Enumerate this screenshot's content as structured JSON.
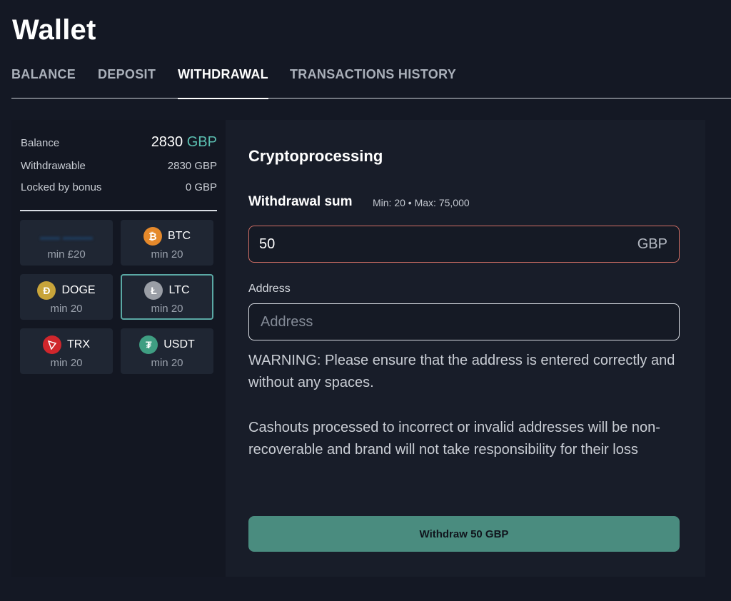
{
  "page_title": "Wallet",
  "tabs": [
    {
      "label": "BALANCE",
      "active": false
    },
    {
      "label": "DEPOSIT",
      "active": false
    },
    {
      "label": "WITHDRAWAL",
      "active": true
    },
    {
      "label": "TRANSACTIONS HISTORY",
      "active": false
    }
  ],
  "balance": {
    "balance_label": "Balance",
    "balance_amount": "2830",
    "balance_currency": "GBP",
    "withdrawable_label": "Withdrawable",
    "withdrawable_value": "2830 GBP",
    "locked_label": "Locked by bonus",
    "locked_value": "0 GBP"
  },
  "methods": [
    {
      "name": "",
      "min": "min £20",
      "icon": "blurred-brand-logo",
      "selected": false
    },
    {
      "name": "BTC",
      "min": "min 20",
      "icon": "bitcoin-icon",
      "color": "#e5892b",
      "selected": false
    },
    {
      "name": "DOGE",
      "min": "min 20",
      "icon": "dogecoin-icon",
      "color": "#c8a43a",
      "selected": false
    },
    {
      "name": "LTC",
      "min": "min 20",
      "icon": "litecoin-icon",
      "color": "#9a9ea6",
      "selected": true
    },
    {
      "name": "TRX",
      "min": "min 20",
      "icon": "tron-icon",
      "color": "#d0262c",
      "selected": false
    },
    {
      "name": "USDT",
      "min": "min 20",
      "icon": "tether-icon",
      "color": "#3f9e82",
      "selected": false
    }
  ],
  "form": {
    "title": "Cryptoprocessing",
    "sum_label": "Withdrawal sum",
    "sum_hint": "Min: 20 • Max: 75,000",
    "sum_value": "50",
    "sum_currency": "GBP",
    "address_label": "Address",
    "address_placeholder": "Address",
    "warning_text": "WARNING: Please ensure that the address is entered correctly and without any spaces.",
    "notice_text": "Cashouts processed to incorrect or invalid addresses will be non-recoverable and brand will not take responsibility for their loss",
    "submit_label": "Withdraw 50 GBP"
  },
  "colors": {
    "background": "#141824",
    "accent": "#4a8c7f",
    "currency_accent": "#5bbfb1",
    "error_border": "#d06e64",
    "selected_border": "#5aa8a4"
  }
}
